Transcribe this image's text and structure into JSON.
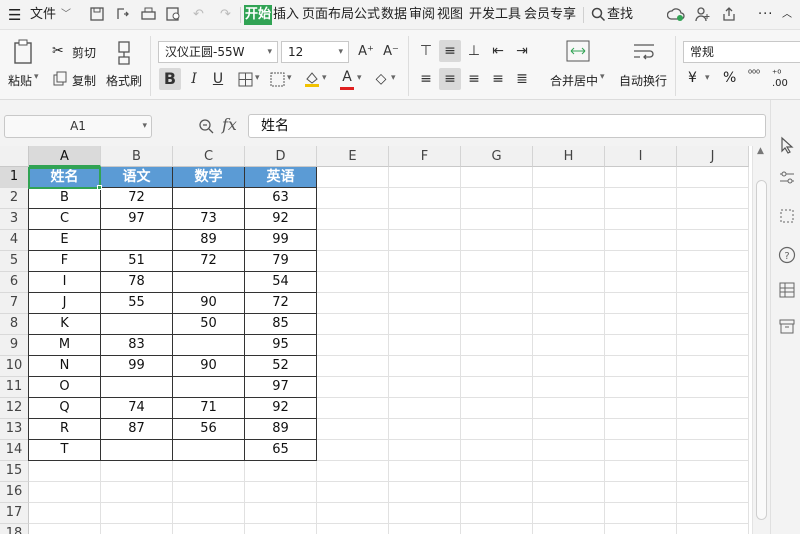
{
  "menu": {
    "file_label": "文件",
    "tabs": [
      "开始",
      "插入",
      "页面布局",
      "公式",
      "数据",
      "审阅",
      "视图",
      "开发工具",
      "会员专享"
    ],
    "active_tab": "开始",
    "search_label": "查找"
  },
  "ribbon": {
    "paste": "粘贴",
    "cut": "剪切",
    "copy": "复制",
    "format_painter": "格式刷",
    "font_name": "汉仪正圆-55W",
    "font_size": "12",
    "merge_center": "合并居中",
    "wrap_text": "自动换行",
    "number_format": "常规",
    "bold": "B",
    "italic": "I",
    "underline": "U",
    "percent": "%"
  },
  "formula_bar": {
    "name_box": "A1",
    "fx_label": "fx",
    "content": "姓名"
  },
  "sheet": {
    "columns": [
      "A",
      "B",
      "C",
      "D",
      "E",
      "F",
      "G",
      "H",
      "I",
      "J"
    ],
    "selected_column": "A",
    "selected_row": "1",
    "row_numbers": [
      "1",
      "2",
      "3",
      "4",
      "5",
      "6",
      "7",
      "8",
      "9",
      "10",
      "11",
      "12",
      "13",
      "14",
      "15",
      "16",
      "17",
      "18"
    ],
    "header": [
      "姓名",
      "语文",
      "数学",
      "英语"
    ],
    "rows": [
      [
        "B",
        "72",
        "",
        "63"
      ],
      [
        "C",
        "97",
        "73",
        "92"
      ],
      [
        "E",
        "",
        "89",
        "99"
      ],
      [
        "F",
        "51",
        "72",
        "79"
      ],
      [
        "I",
        "78",
        "",
        "54"
      ],
      [
        "J",
        "55",
        "90",
        "72"
      ],
      [
        "K",
        "",
        "50",
        "85"
      ],
      [
        "M",
        "83",
        "",
        "95"
      ],
      [
        "N",
        "99",
        "90",
        "52"
      ],
      [
        "O",
        "",
        "",
        "97"
      ],
      [
        "Q",
        "74",
        "71",
        "92"
      ],
      [
        "R",
        "87",
        "56",
        "89"
      ],
      [
        "T",
        "",
        "",
        "65"
      ]
    ],
    "header_color": "#5b9bd5",
    "selection_color": "#31a354"
  },
  "colors": {
    "accent": "#31a354"
  },
  "sidebar_icons": [
    "pointer-icon",
    "properties-icon",
    "selection-icon",
    "help-icon",
    "table-style-icon",
    "archive-icon"
  ]
}
